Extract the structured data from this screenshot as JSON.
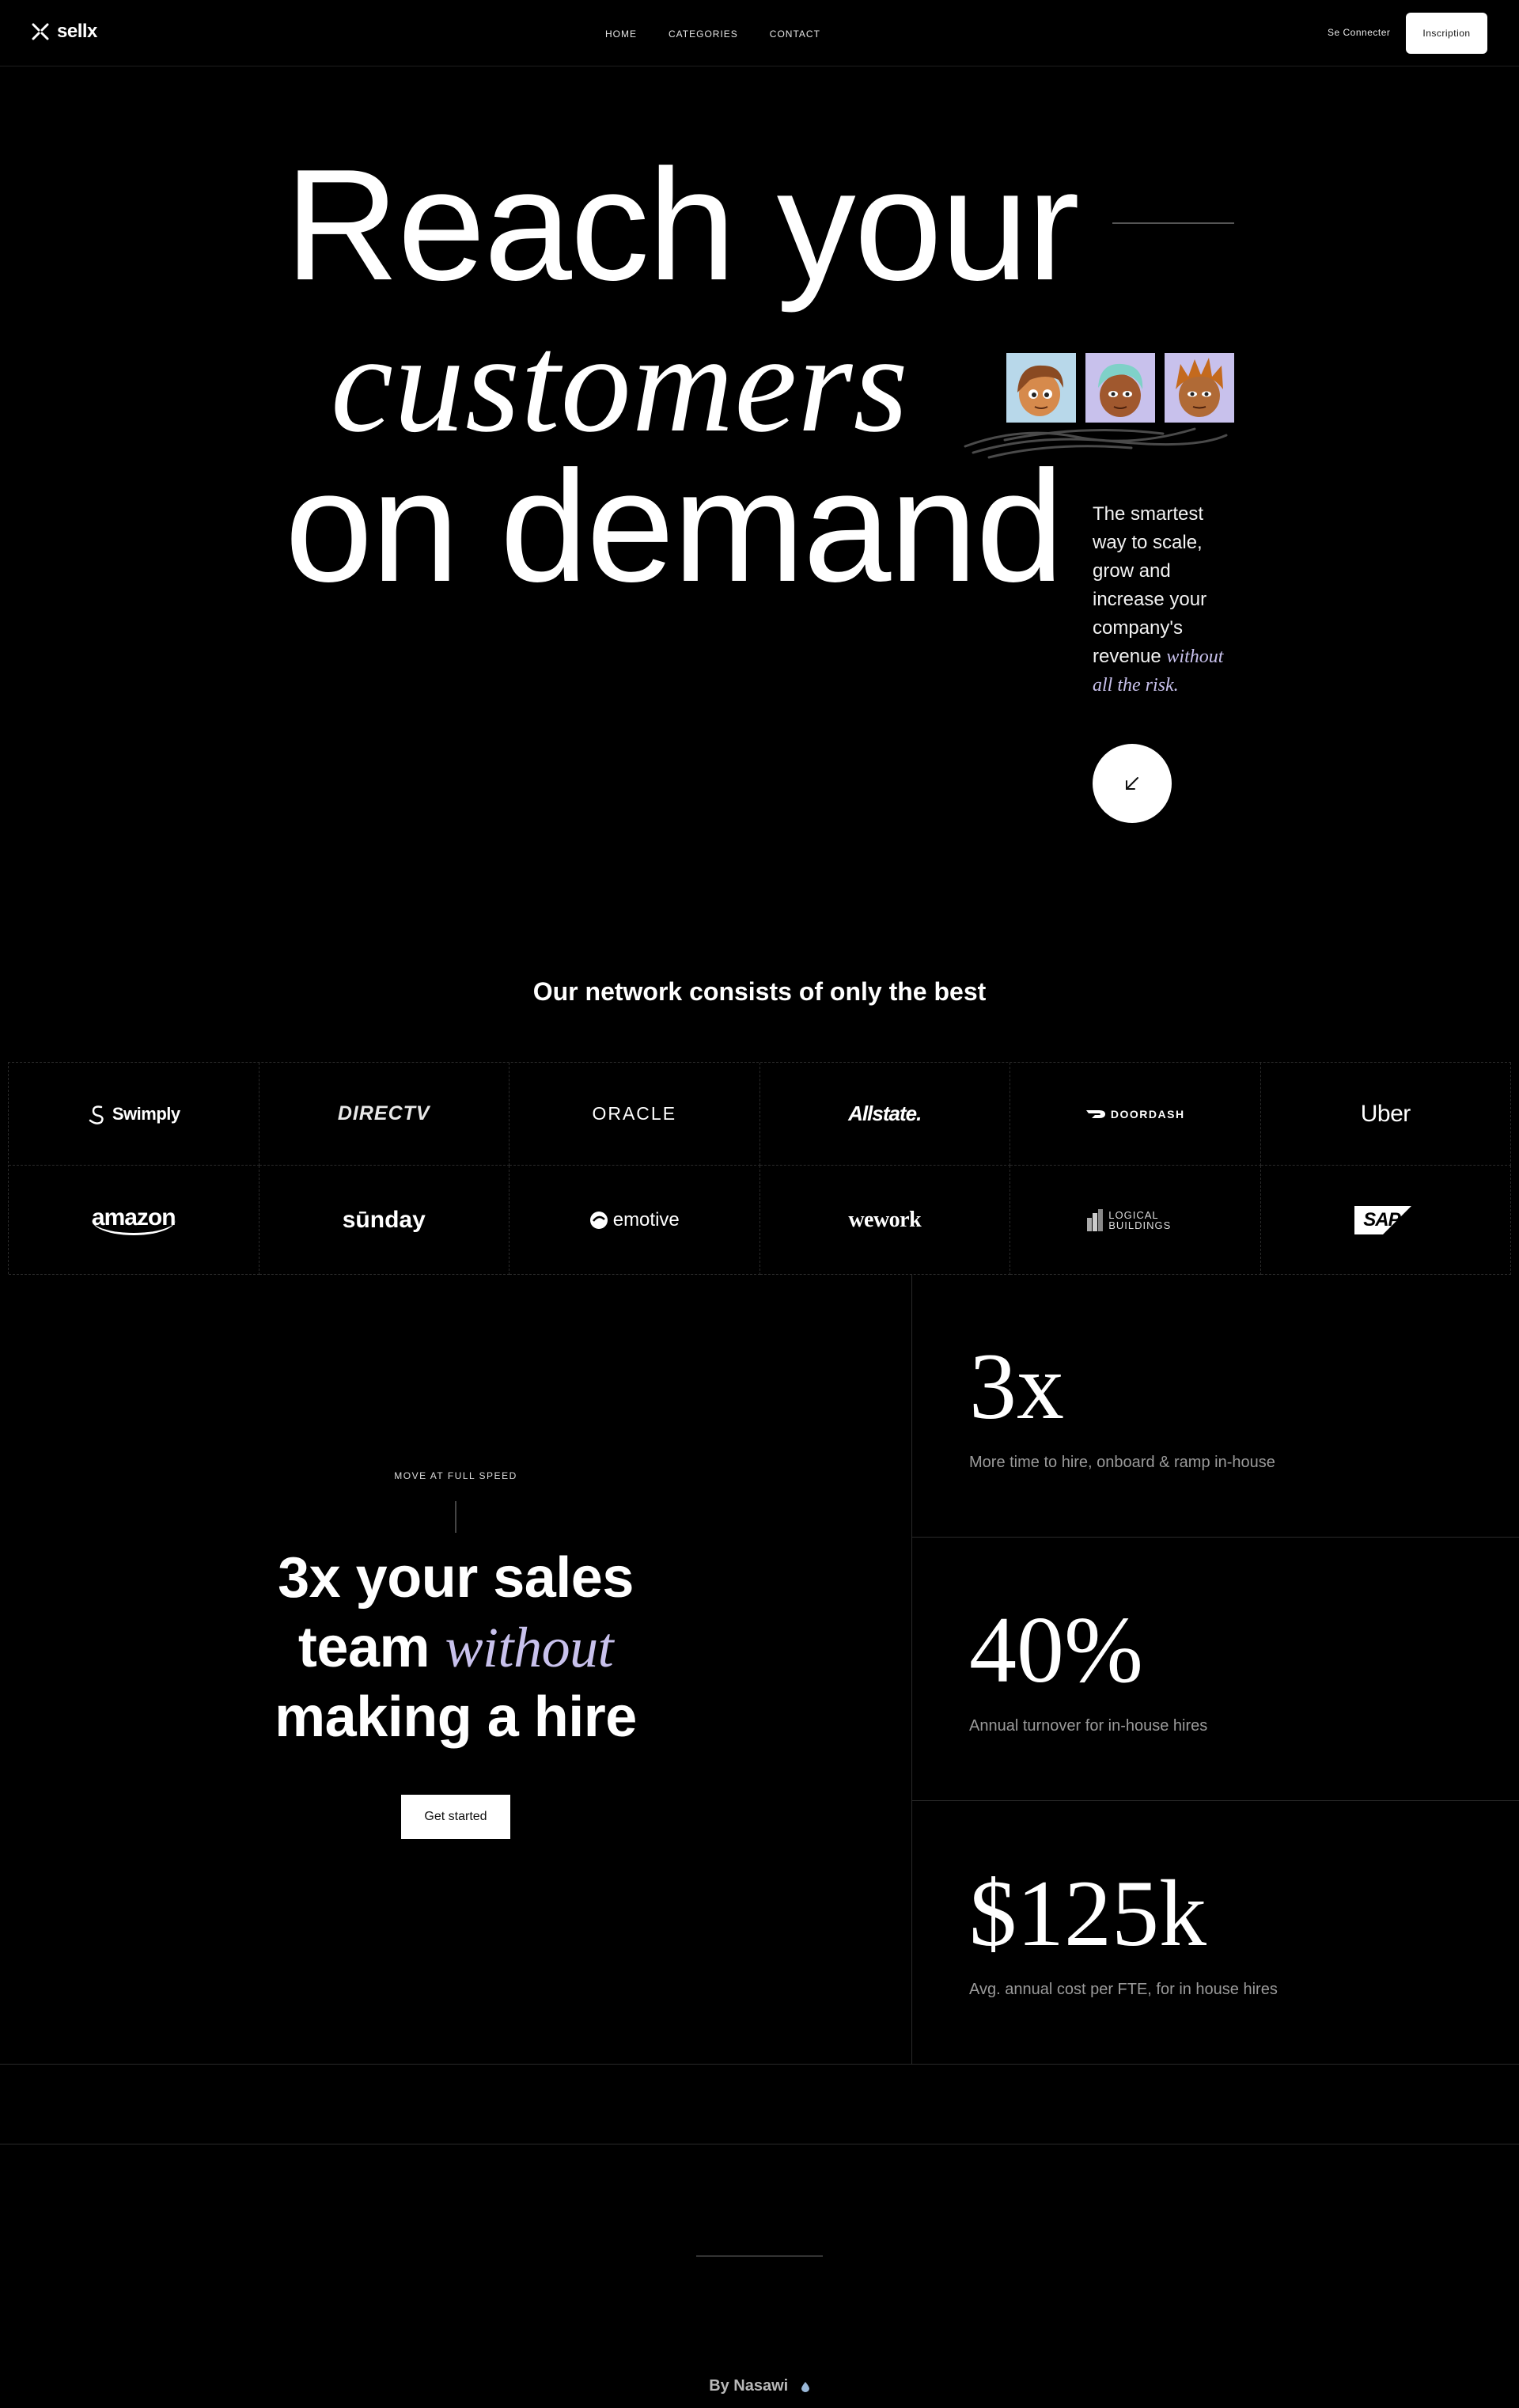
{
  "nav": {
    "brand": "sellx",
    "links": [
      "HOME",
      "CATEGORIES",
      "CONTACT"
    ],
    "login_label": "Se Connecter",
    "signup_label": "Inscription"
  },
  "hero": {
    "line1": "Reach your",
    "line2": "customers",
    "line3": "on demand",
    "description": "The smartest way to scale, grow and increase your company's revenue",
    "description_em": "without all the risk.",
    "arrow_icon": "arrow-down-left-icon"
  },
  "network": {
    "title": "Our network consists of only the best",
    "brands": [
      "Swimply",
      "DIRECTV",
      "ORACLE",
      "Allstate.",
      "DOORDASH",
      "Uber",
      "amazon",
      "sūnday",
      "emotive",
      "wework",
      "LOGICAL BUILDINGS",
      "SAP"
    ]
  },
  "pitch": {
    "eyebrow": "MOVE AT FULL SPEED",
    "line1": "3x your sales",
    "line2_start": "team",
    "line2_em": "without",
    "line3": "making a hire",
    "cta_label": "Get started"
  },
  "stats": [
    {
      "value": "3x",
      "label": "More time to hire, onboard & ramp in-house"
    },
    {
      "value": "40%",
      "label": "Annual turnover for in-house hires"
    },
    {
      "value": "$125k",
      "label": "Avg. annual cost per FTE, for in house hires"
    }
  ],
  "footer": {
    "credit": "By Nasawi"
  },
  "colors": {
    "background": "#000000",
    "accent": "#c8c1ec",
    "muted_text": "#9a9a9a",
    "border": "#2a2a2a"
  }
}
